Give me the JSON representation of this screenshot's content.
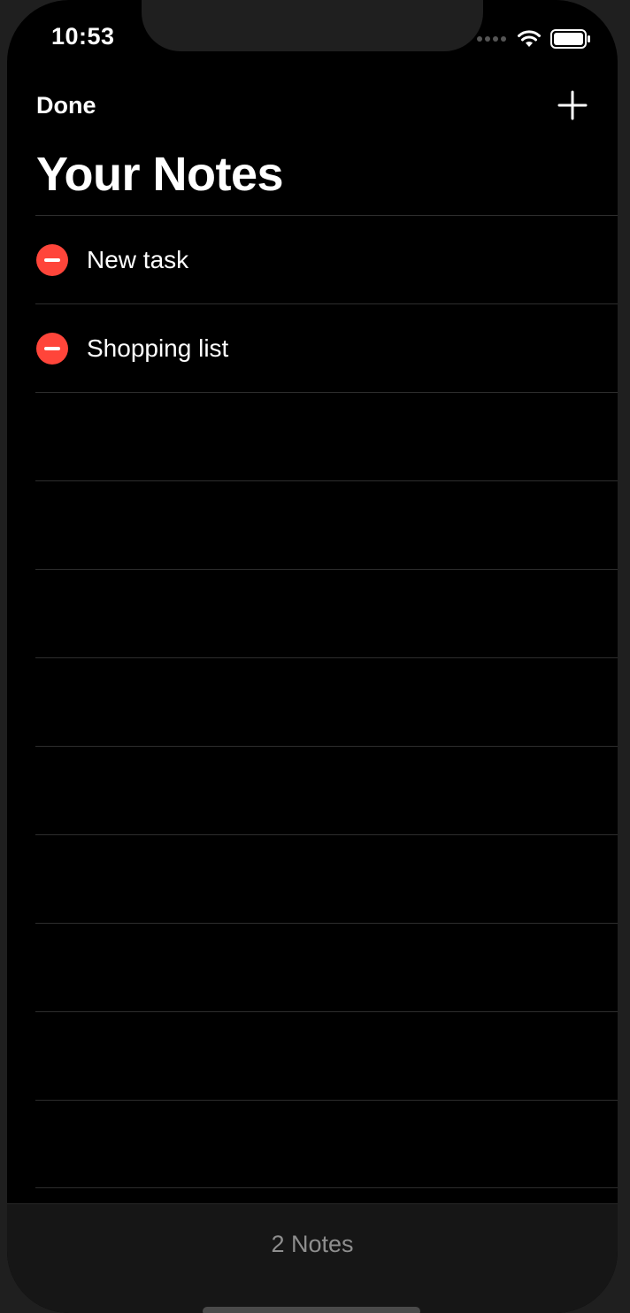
{
  "status_bar": {
    "time": "10:53",
    "icons": [
      "signal-icon",
      "wifi-icon",
      "battery-icon"
    ]
  },
  "nav": {
    "done_label": "Done",
    "add_icon": "plus-icon"
  },
  "title": "Your Notes",
  "notes": [
    {
      "label": "New task"
    },
    {
      "label": "Shopping list"
    }
  ],
  "footer": {
    "count_label": "2 Notes"
  },
  "colors": {
    "background": "#000000",
    "delete": "#ff453a",
    "text": "#ffffff",
    "secondary_text": "#8e8e8e"
  }
}
